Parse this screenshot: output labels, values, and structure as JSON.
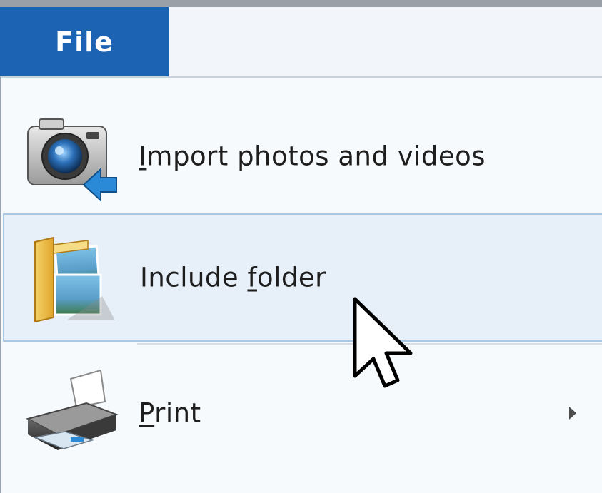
{
  "window": {
    "file_tab": "File"
  },
  "menu": {
    "items": [
      {
        "label_pre": "",
        "label_accel": "I",
        "label_post": "mport photos and videos",
        "icon": "camera-import-icon"
      },
      {
        "label_pre": "Include ",
        "label_accel": "f",
        "label_post": "older",
        "icon": "pictures-folder-icon"
      },
      {
        "label_pre": "",
        "label_accel": "P",
        "label_post": "rint",
        "icon": "printer-icon"
      }
    ]
  },
  "colors": {
    "file_tab_bg": "#1c63b3",
    "hover_bg": "#e7eff8",
    "hover_border": "#a9c8e6"
  }
}
